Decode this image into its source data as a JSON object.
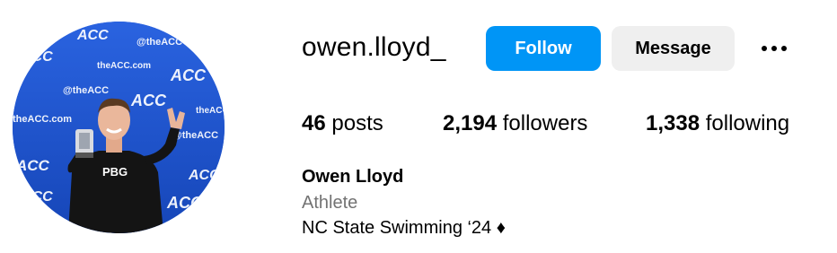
{
  "profile": {
    "username": "owen.lloyd_",
    "full_name": "Owen Lloyd",
    "category": "Athlete",
    "bio": "NC State Swimming ‘24 ♦",
    "avatar_icon": "profile-photo",
    "avatar_backdrop_text": [
      "@theACC",
      "theACC.com",
      "ACC"
    ],
    "shirt_text": "PBG"
  },
  "actions": {
    "follow_label": "Follow",
    "message_label": "Message",
    "more_icon": "more-options-icon"
  },
  "stats": {
    "posts_count": "46",
    "posts_label": "posts",
    "followers_count": "2,194",
    "followers_label": "followers",
    "following_count": "1,338",
    "following_label": "following"
  },
  "colors": {
    "primary_button": "#0095f6",
    "secondary_button": "#efefef",
    "secondary_text": "#737373",
    "backdrop_blue": "#1c56d6"
  }
}
